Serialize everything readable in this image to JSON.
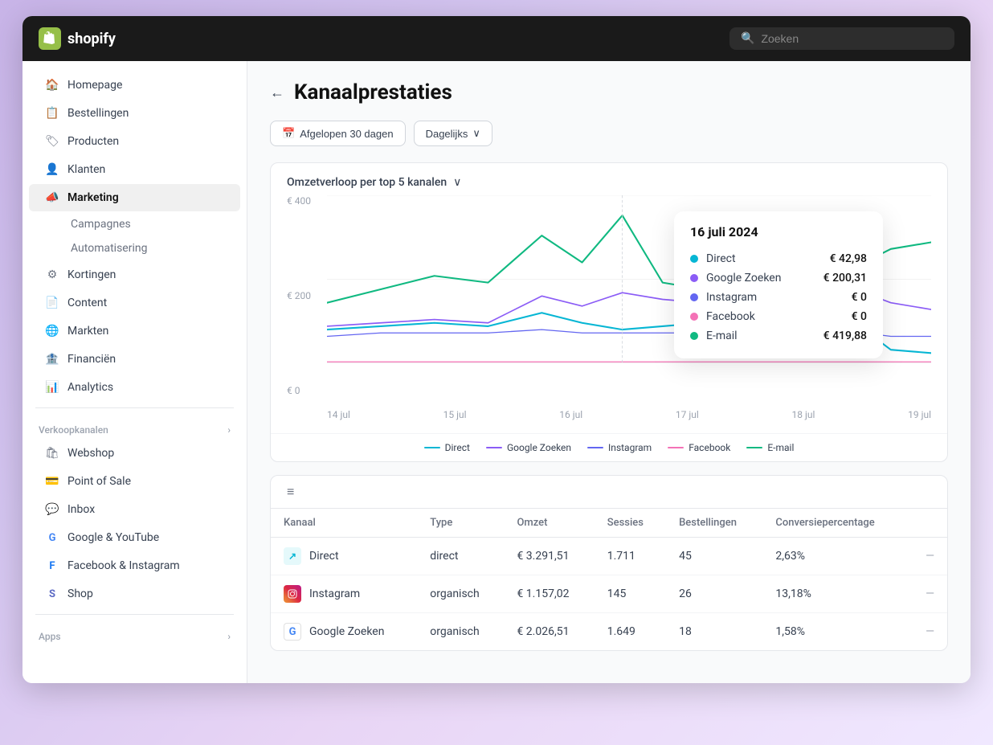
{
  "header": {
    "logo_text": "shopify",
    "search_placeholder": "Zoeken"
  },
  "sidebar": {
    "nav_items": [
      {
        "id": "homepage",
        "label": "Homepage",
        "icon": "🏠"
      },
      {
        "id": "bestellingen",
        "label": "Bestellingen",
        "icon": "📋"
      },
      {
        "id": "producten",
        "label": "Producten",
        "icon": "🏷"
      },
      {
        "id": "klanten",
        "label": "Klanten",
        "icon": "👤"
      },
      {
        "id": "marketing",
        "label": "Marketing",
        "icon": "📣",
        "active": true
      },
      {
        "id": "kortingen",
        "label": "Kortingen",
        "icon": "⚙"
      },
      {
        "id": "content",
        "label": "Content",
        "icon": "📄"
      },
      {
        "id": "markten",
        "label": "Markten",
        "icon": "🌐"
      },
      {
        "id": "financien",
        "label": "Financiën",
        "icon": "🏦"
      },
      {
        "id": "analytics",
        "label": "Analytics",
        "icon": "📊"
      }
    ],
    "marketing_sub": [
      "Campagnes",
      "Automatisering"
    ],
    "sections": {
      "verkoopkanalen": "Verkoopkanalen",
      "apps": "Apps"
    },
    "kanalen_items": [
      {
        "id": "webshop",
        "label": "Webshop",
        "icon": "🛍"
      },
      {
        "id": "pos",
        "label": "Point of Sale",
        "icon": "💳"
      },
      {
        "id": "inbox",
        "label": "Inbox",
        "icon": "💬"
      },
      {
        "id": "google",
        "label": "Google & YouTube",
        "icon": "G"
      },
      {
        "id": "facebook",
        "label": "Facebook & Instagram",
        "icon": "F"
      },
      {
        "id": "shop",
        "label": "Shop",
        "icon": "S"
      }
    ]
  },
  "main": {
    "back_button": "←",
    "title": "Kanaalprestaties",
    "toolbar": {
      "date_range": "Afgelopen 30 dagen",
      "interval": "Dagelijks"
    },
    "chart": {
      "title": "Omzetverloop per top 5 kanalen",
      "y_labels": [
        "€ 400",
        "€ 200",
        "€ 0"
      ],
      "x_labels": [
        "14 jul",
        "15 jul",
        "16 jul",
        "17 jul",
        "18 jul",
        "19 jul"
      ],
      "legend": [
        {
          "label": "Direct",
          "color": "#06b6d4"
        },
        {
          "label": "Google Zoeken",
          "color": "#8b5cf6"
        },
        {
          "label": "Instagram",
          "color": "#6366f1"
        },
        {
          "label": "Facebook",
          "color": "#f472b6"
        },
        {
          "label": "E-mail",
          "color": "#10b981"
        }
      ]
    },
    "tooltip": {
      "date": "16 juli 2024",
      "rows": [
        {
          "label": "Direct",
          "color": "#06b6d4",
          "value": "€ 42,98"
        },
        {
          "label": "Google Zoeken",
          "color": "#8b5cf6",
          "value": "€ 200,31"
        },
        {
          "label": "Instagram",
          "color": "#6366f1",
          "value": "€ 0"
        },
        {
          "label": "Facebook",
          "color": "#f472b6",
          "value": "€ 0"
        },
        {
          "label": "E-mail",
          "color": "#10b981",
          "value": "€ 419,88"
        }
      ]
    },
    "table": {
      "columns": [
        "Kanaal",
        "Type",
        "Omzet",
        "Sessies",
        "Bestellingen",
        "Conversiepercentage",
        ""
      ],
      "rows": [
        {
          "channel": "Direct",
          "icon_type": "direct",
          "type": "direct",
          "omzet": "€ 3.291,51",
          "sessies": "1.711",
          "bestellingen": "45",
          "conversie": "2,63%"
        },
        {
          "channel": "Instagram",
          "icon_type": "instagram",
          "type": "organisch",
          "omzet": "€ 1.157,02",
          "sessies": "145",
          "bestellingen": "26",
          "conversie": "13,18%"
        },
        {
          "channel": "Google Zoeken",
          "icon_type": "google",
          "type": "organisch",
          "omzet": "€ 2.026,51",
          "sessies": "1.649",
          "bestellingen": "18",
          "conversie": "1,58%"
        }
      ]
    }
  }
}
